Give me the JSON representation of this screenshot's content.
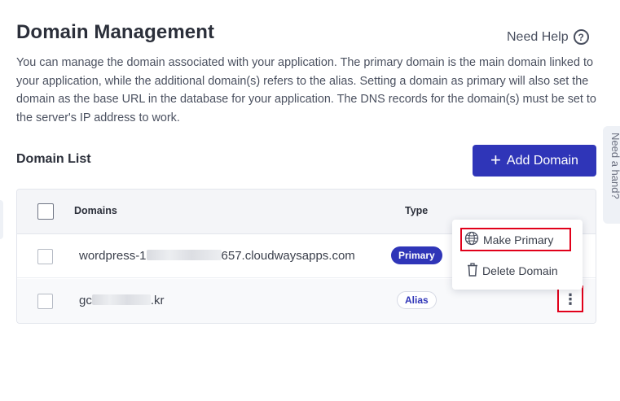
{
  "page": {
    "title": "Domain Management",
    "help_label": "Need Help",
    "help_icon_glyph": "?",
    "description": "You can manage the domain associated with your application. The primary domain is the main domain linked to your application, while the additional domain(s) refers to the alias. Setting a domain as primary will also set the domain as the base URL in the database for your application. The DNS records for the domain(s) must be set to the server's IP address to work.",
    "side_tab_label": "Need a hand?"
  },
  "domain_list": {
    "title": "Domain List",
    "add_button_label": "Add Domain",
    "add_button_icon": "+",
    "columns": [
      "Domains",
      "Type"
    ],
    "rows": [
      {
        "domain_prefix": "wordpress-1",
        "domain_suffix": "657.cloudwaysapps.com",
        "type": "Primary"
      },
      {
        "domain_prefix": "gc",
        "domain_suffix": ".kr",
        "type": "Alias"
      }
    ]
  },
  "context_menu": {
    "items": [
      {
        "label": "Make Primary",
        "icon": "globe-icon"
      },
      {
        "label": "Delete Domain",
        "icon": "trash-icon"
      }
    ]
  },
  "colors": {
    "brand": "#2f35b8",
    "highlight": "#e1001a",
    "text": "#2b2f3a"
  }
}
